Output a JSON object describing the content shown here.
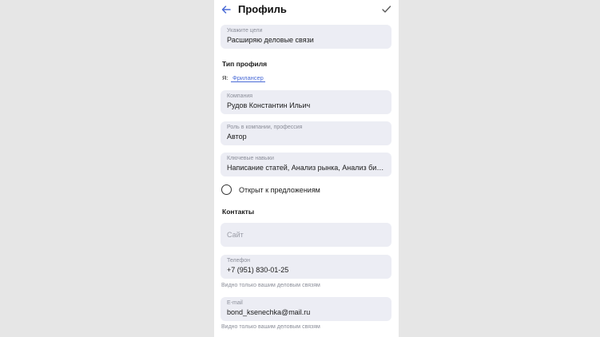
{
  "header": {
    "title": "Профиль"
  },
  "fields": {
    "goal": {
      "label": "Укажите цели",
      "value": "Расширяю деловые связи"
    },
    "company": {
      "label": "Компания",
      "value": "Рудов Константин Ильич"
    },
    "role": {
      "label": "Роль в компании, профессия",
      "value": "Автор"
    },
    "skills": {
      "label": "Ключевые навыки",
      "value": "Написание статей, Анализ рынка, Анализ бизне..."
    },
    "site": {
      "placeholder": "Сайт"
    },
    "phone": {
      "label": "Телефон",
      "value": "+7 (951) 830-01-25"
    },
    "email": {
      "label": "E-mail",
      "value": "bond_ksenechka@mail.ru"
    }
  },
  "profile_type": {
    "section_title": "Тип профиля",
    "me_label": "Я:",
    "selected_tab": "Фрилансер"
  },
  "open_to_offers": {
    "label": "Открыт к предложениям",
    "checked": false
  },
  "contacts": {
    "section_title": "Контакты",
    "phone_hint": "Видно только вашим деловым связям",
    "email_hint": "Видно только вашим деловым связям"
  },
  "colors": {
    "accent": "#4a6bd6",
    "field_bg": "#ecedf4",
    "page_bg": "#e6e6e6"
  }
}
